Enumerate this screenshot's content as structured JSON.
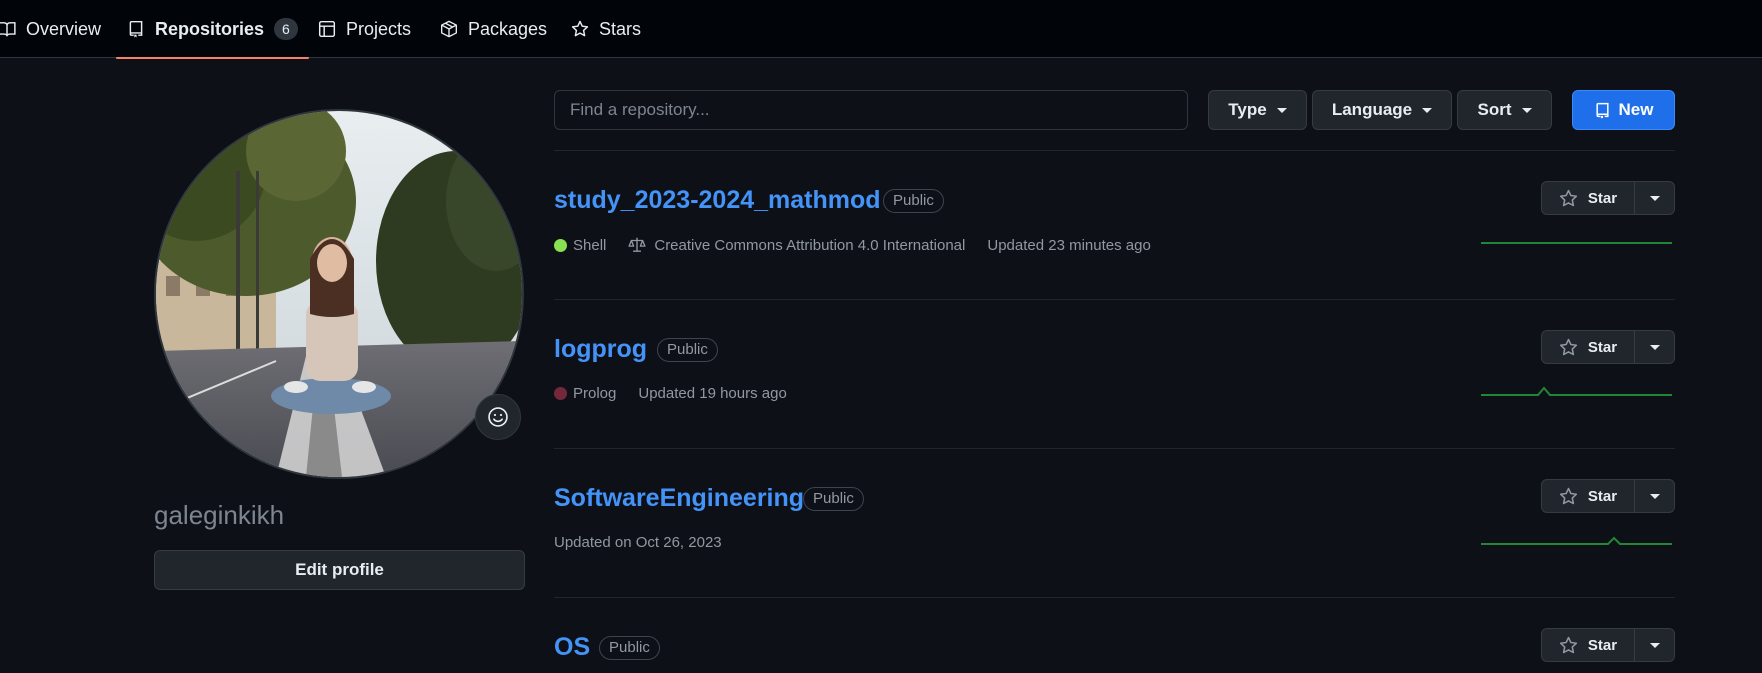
{
  "nav": {
    "tabs": [
      {
        "label": "Overview"
      },
      {
        "label": "Repositories",
        "count": "6"
      },
      {
        "label": "Projects"
      },
      {
        "label": "Packages"
      },
      {
        "label": "Stars"
      }
    ]
  },
  "profile": {
    "username": "galeginkikh",
    "edit_label": "Edit profile"
  },
  "toolbar": {
    "search_placeholder": "Find a repository...",
    "type_label": "Type",
    "language_label": "Language",
    "sort_label": "Sort",
    "new_label": "New"
  },
  "repos": [
    {
      "name": "study_2023-2024_mathmod",
      "visibility": "Public",
      "language": "Shell",
      "language_color": "#89e051",
      "license": "Creative Commons Attribution 4.0 International",
      "updated": "Updated 23 minutes ago",
      "star_label": "Star"
    },
    {
      "name": "logprog",
      "visibility": "Public",
      "language": "Prolog",
      "language_color": "#74283c",
      "updated": "Updated 19 hours ago",
      "star_label": "Star"
    },
    {
      "name": "SoftwareEngineering",
      "visibility": "Public",
      "updated": "Updated on Oct 26, 2023",
      "star_label": "Star"
    },
    {
      "name": "OS",
      "visibility": "Public",
      "star_label": "Star"
    }
  ],
  "colors": {
    "background": "#0d1117",
    "link": "#4493f8",
    "primary_button": "#1f6feb",
    "active_tab_underline": "#f78166",
    "sparkline": "#238636"
  }
}
